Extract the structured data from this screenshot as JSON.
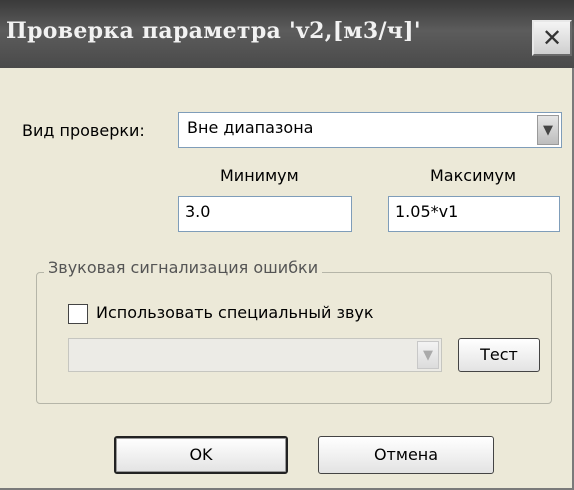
{
  "dialog": {
    "title": "Проверка параметра 'v2,[м3/ч]'",
    "close_glyph": "✕",
    "check_type_label": "Вид проверки:",
    "check_type_value": "Вне диапазона",
    "min_label": "Минимум",
    "max_label": "Максимум",
    "min_value": "3.0",
    "max_value": "1.05*v1",
    "sound_group_caption": "Звуковая сигнализация ошибки",
    "use_special_sound_label": "Использовать специальный звук",
    "use_special_sound_checked": false,
    "sound_select_value": "",
    "test_button": "Тест",
    "ok_button": "OK",
    "cancel_button": "Отмена"
  },
  "colors": {
    "titlebar": "#4a4a4a",
    "dialog_bg": "#ece9d8"
  },
  "icons": {
    "close": "close-icon",
    "dropdown": "chevron-down-icon"
  }
}
